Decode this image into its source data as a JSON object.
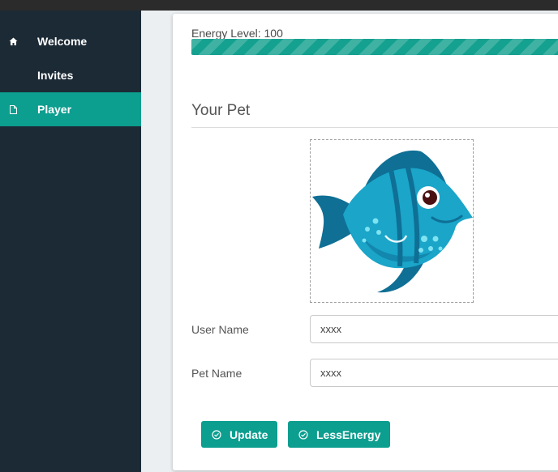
{
  "nav": {
    "items": [
      {
        "label": "Welcome",
        "icon": "home-icon"
      },
      {
        "label": "Invites",
        "icon": ""
      },
      {
        "label": "Player",
        "icon": "document-icon"
      }
    ],
    "active_index": 2
  },
  "energy": {
    "label": "Energy Level: 100",
    "level_percent": 100
  },
  "pet_section": {
    "title": "Your Pet",
    "image": "cartoon-fish"
  },
  "form": {
    "user_name": {
      "label": "User Name",
      "value": "xxxx"
    },
    "pet_name": {
      "label": "Pet Name",
      "value": "xxxx"
    }
  },
  "actions": {
    "update_label": "Update",
    "less_energy_label": "LessEnergy",
    "icon": "check-circle-icon"
  },
  "colors": {
    "accent": "#0c9e8f",
    "sidebar": "#1c2a36",
    "fish_body": "#1aa5c9",
    "fish_dark": "#0f6f95"
  }
}
